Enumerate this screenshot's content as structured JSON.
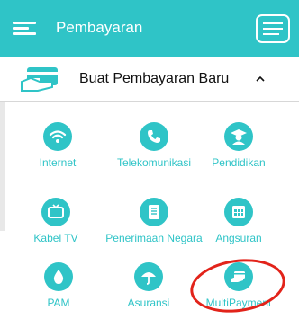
{
  "header": {
    "title": "Pembayaran",
    "menu_icon": "hamburger-menu-icon",
    "right_icon": "list-view-icon",
    "color": "#2fc4c7"
  },
  "section": {
    "label": "Buat Pembayaran Baru",
    "icon": "payment-card-hand-icon",
    "expand_icon": "caret-up-icon"
  },
  "items": [
    {
      "label": "Internet",
      "icon": "wifi-icon"
    },
    {
      "label": "Telekomunikasi",
      "icon": "phone-icon"
    },
    {
      "label": "Pendidikan",
      "icon": "graduate-icon"
    },
    {
      "label": "Kabel TV",
      "icon": "tv-icon"
    },
    {
      "label": "Penerimaan Negara",
      "icon": "document-icon"
    },
    {
      "label": "Angsuran",
      "icon": "calendar-icon"
    },
    {
      "label": "PAM",
      "icon": "water-drop-icon"
    },
    {
      "label": "Asuransi",
      "icon": "umbrella-icon"
    },
    {
      "label": "MultiPayment",
      "icon": "card-payment-icon"
    }
  ],
  "annotation": {
    "color": "#e2231a",
    "target": "MultiPayment"
  }
}
